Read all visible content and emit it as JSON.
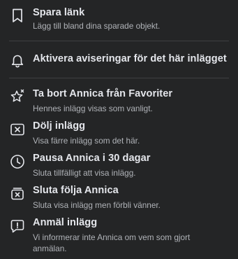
{
  "menu": {
    "items": [
      {
        "icon": "bookmark-icon",
        "title": "Spara länk",
        "description": "Lägg till bland dina sparade objekt."
      },
      {
        "icon": "bell-icon",
        "title": "Aktivera aviseringar för det här inlägget",
        "description": ""
      },
      {
        "icon": "star-remove-icon",
        "title": "Ta bort Annica från Favoriter",
        "description": "Hennes inlägg visas som vanligt."
      },
      {
        "icon": "hide-box-icon",
        "title": "Dölj inlägg",
        "description": "Visa färre inlägg som det här."
      },
      {
        "icon": "clock-icon",
        "title": "Pausa Annica i 30 dagar",
        "description": "Sluta tillfälligt att visa inlägg."
      },
      {
        "icon": "unfollow-icon",
        "title": "Sluta följa Annica",
        "description": "Sluta visa inlägg men förbli vänner."
      },
      {
        "icon": "report-icon",
        "title": "Anmäl inlägg",
        "description": "Vi informerar inte Annica om vem som gjort anmälan."
      }
    ]
  }
}
